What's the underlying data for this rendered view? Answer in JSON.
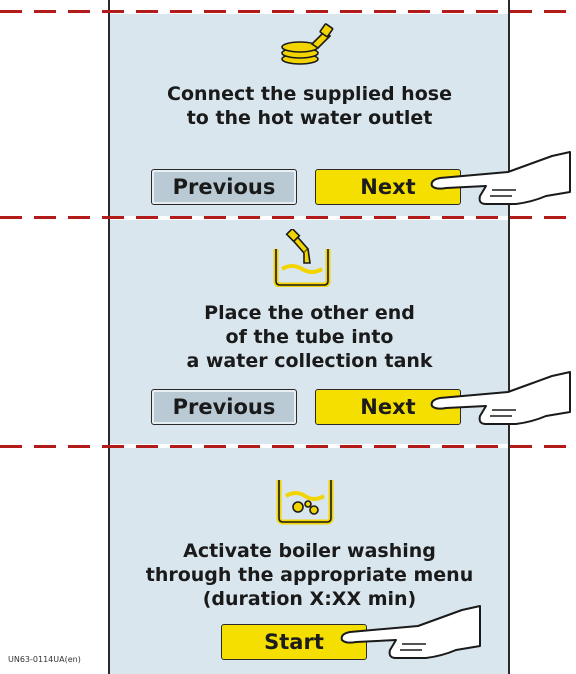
{
  "steps": [
    {
      "icon": "hose-outlet-icon",
      "message": [
        "Connect the supplied hose",
        "to the hot water outlet"
      ],
      "previous_label": "Previous",
      "next_label": "Next"
    },
    {
      "icon": "tank-hose-icon",
      "message": [
        "Place the other end",
        "of the tube into",
        "a water collection tank"
      ],
      "previous_label": "Previous",
      "next_label": "Next"
    },
    {
      "icon": "boiler-wash-icon",
      "message": [
        "Activate boiler washing",
        "through the appropriate menu",
        "(duration X:XX min)"
      ],
      "start_label": "Start"
    }
  ],
  "footer_code": "UN63-0114UA(en)",
  "colors": {
    "panel": "#d9e6ee",
    "primary_button": "#f4df00",
    "secondary_button": "#b9cad4",
    "divider": "#b31a1a",
    "icon": "#f2d400"
  }
}
